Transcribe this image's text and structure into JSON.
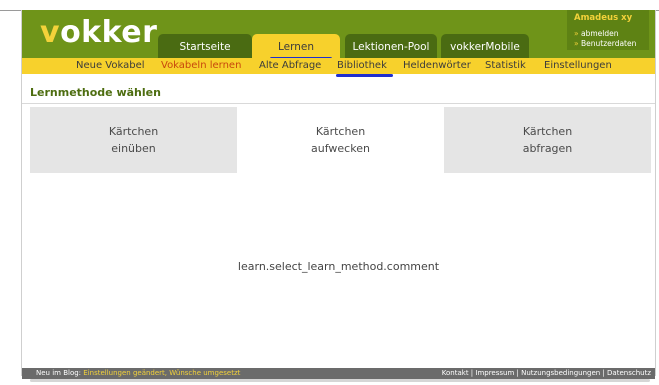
{
  "header": {
    "logo_first": "v",
    "logo_rest": "okker",
    "tabs": [
      {
        "label": "Startseite",
        "active": false
      },
      {
        "label": "Lernen",
        "active": true
      },
      {
        "label": "Lektionen-Pool",
        "active": false
      },
      {
        "label": "vokkerMobile",
        "active": false
      }
    ],
    "user": {
      "name": "Amadeus xy",
      "links": [
        "abmelden",
        "Benutzerdaten"
      ]
    }
  },
  "subnav": {
    "items": [
      {
        "label": "Neue Vokabel",
        "active": false
      },
      {
        "label": "Vokabeln lernen",
        "active": true
      },
      {
        "label": "Alte Abfrage",
        "active": false
      },
      {
        "label": "Bibliothek",
        "active": false
      },
      {
        "label": "Heldenwörter",
        "active": false
      },
      {
        "label": "Statistik",
        "active": false
      },
      {
        "label": "Einstellungen",
        "active": false
      }
    ]
  },
  "main": {
    "title": "Lernmethode wählen",
    "methods": [
      {
        "line1": "Kärtchen",
        "line2": "einüben"
      },
      {
        "line1": "Kärtchen",
        "line2": "aufwecken"
      },
      {
        "line1": "Kärtchen",
        "line2": "abfragen"
      }
    ],
    "comment": "learn.select_learn_method.comment"
  },
  "footer": {
    "blog_prefix": "Neu im Blog:",
    "blog_link": "Einstellungen geändert, Wünsche umgesetzt",
    "links_text": "Kontakt | Impressum | Nutzungsbedingungen | Datenschutz"
  },
  "colors": {
    "header_green": "#6f9419",
    "tab_dark": "#4a6b12",
    "yellow": "#f7d12c",
    "active_orange": "#c8470d",
    "annotation_blue": "#1e2fcf"
  }
}
